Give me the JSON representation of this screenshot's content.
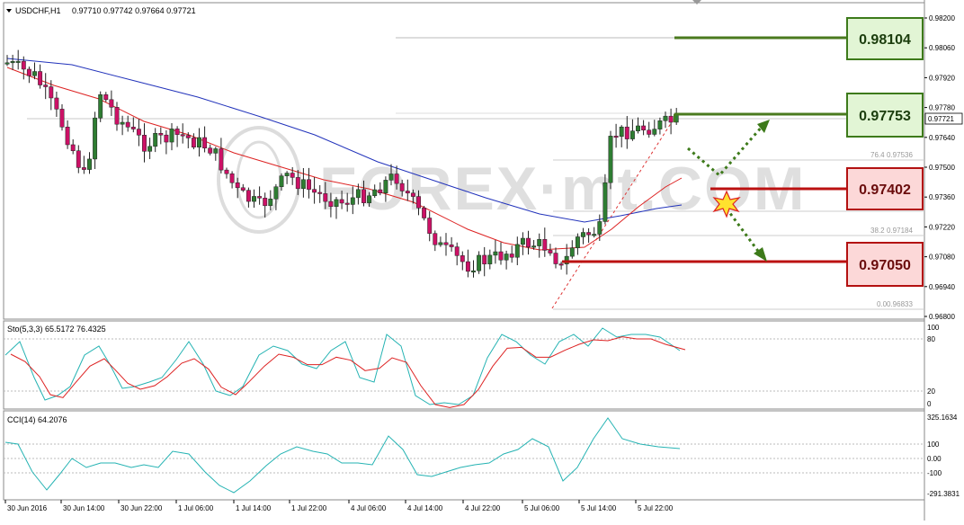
{
  "main_header": {
    "symbol": "USDCHF,H1",
    "ohlc": "0.97710 0.97742 0.97664 0.97721"
  },
  "main_axis": {
    "labels": [
      "0.98200",
      "0.98060",
      "0.97920",
      "0.97780",
      "0.97640",
      "0.97500",
      "0.97360",
      "0.97220",
      "0.97080",
      "0.96940",
      "0.96800"
    ],
    "current_price": "0.97721"
  },
  "fibo": {
    "l764": "76.4",
    "v764": "0.97536",
    "l382": "38.2",
    "v382": "0.97184",
    "l0": "0.0",
    "v0": "0.96833"
  },
  "levels": {
    "l1": "0.98104",
    "l2": "0.97753",
    "l3": "0.97402",
    "l4": "0.97050"
  },
  "watermark": "FOREX·mt.COM",
  "sto": {
    "label": "Sto(5,3,3) 65.5172 76.4325",
    "axis": [
      "100",
      "80",
      "20",
      "0"
    ]
  },
  "cci": {
    "label": "CCI(14) 64.2076",
    "axis": [
      "325.1634",
      "100",
      "0.00",
      "-100",
      "-291.3831"
    ]
  },
  "time_axis": [
    "30 Jun 2016",
    "30 Jun 14:00",
    "30 Jun 22:00",
    "1 Jul 06:00",
    "1 Jul 14:00",
    "1 Jul 22:00",
    "4 Jul 06:00",
    "4 Jul 14:00",
    "4 Jul 22:00",
    "5 Jul 06:00",
    "5 Jul 14:00",
    "5 Jul 22:00"
  ],
  "colors": {
    "bull": "#2e7d32",
    "bear": "#cc1166",
    "ma_fast": "#dd2222",
    "ma_slow": "#2233bb",
    "sto_main": "#25b3b3",
    "sto_signal": "#dd2222",
    "cci": "#25b3b3",
    "resistance": "#4a7a1e",
    "support": "#bb1111"
  }
}
